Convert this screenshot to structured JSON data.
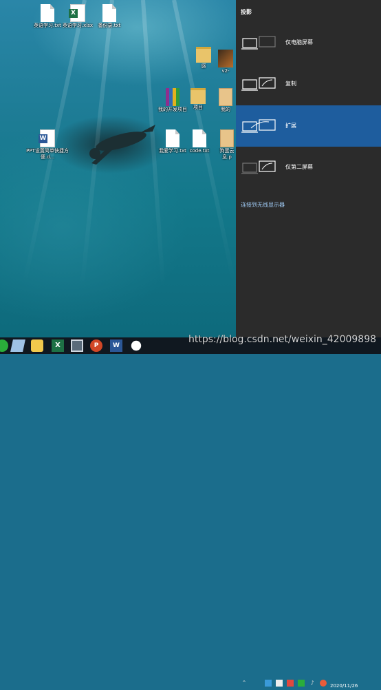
{
  "desktop": {
    "icons": [
      {
        "label": "英语学习.txt",
        "type": "file"
      },
      {
        "label": "英语学习.xlsx",
        "type": "xls"
      },
      {
        "label": "备份录.txt",
        "type": "file"
      },
      {
        "label": "感",
        "type": "folder"
      },
      {
        "label": "v2-",
        "type": "img"
      },
      {
        "label": "我的开发项目",
        "type": "rar"
      },
      {
        "label": "项目",
        "type": "folder"
      },
      {
        "label": "我的",
        "type": "pdfish"
      },
      {
        "label": "PPT设置简单快捷方便.d...",
        "type": "doc"
      },
      {
        "label": "我爱学习.txt",
        "type": "file"
      },
      {
        "label": "code.txt",
        "type": "file"
      },
      {
        "label": "狗蛋云息.p",
        "type": "pdfish"
      }
    ]
  },
  "panel": {
    "title": "投影",
    "options": [
      {
        "label": "仅电脑屏幕",
        "icon": "pc-screen-only-icon",
        "selected": false
      },
      {
        "label": "复制",
        "icon": "duplicate-icon",
        "selected": false
      },
      {
        "label": "扩展",
        "icon": "extend-icon",
        "selected": true
      },
      {
        "label": "仅第二屏幕",
        "icon": "second-screen-only-icon",
        "selected": false
      }
    ],
    "wireless_link": "连接到无线显示器"
  },
  "taskbar": {
    "apps": [
      {
        "name": "wechat-like-green-icon",
        "color": "#2aae3a"
      },
      {
        "name": "notes-icon",
        "color": "#9fc3e6"
      },
      {
        "name": "paint-icon",
        "color": "#f2c94c"
      },
      {
        "name": "excel-icon",
        "color": "#1e7145"
      },
      {
        "name": "calculator-icon",
        "color": "#5a6b7a"
      },
      {
        "name": "powerpoint-icon",
        "color": "#d24726"
      },
      {
        "name": "word-icon",
        "color": "#2b5797"
      },
      {
        "name": "wechat-icon",
        "color": "#ffffff"
      }
    ],
    "date": "2020/11/26"
  },
  "watermark": "https://blog.csdn.net/weixin_42009898",
  "colors": {
    "panel_bg": "#2b2b2b",
    "selected_bg": "#1e5d9e",
    "link": "#9cc6ef"
  }
}
